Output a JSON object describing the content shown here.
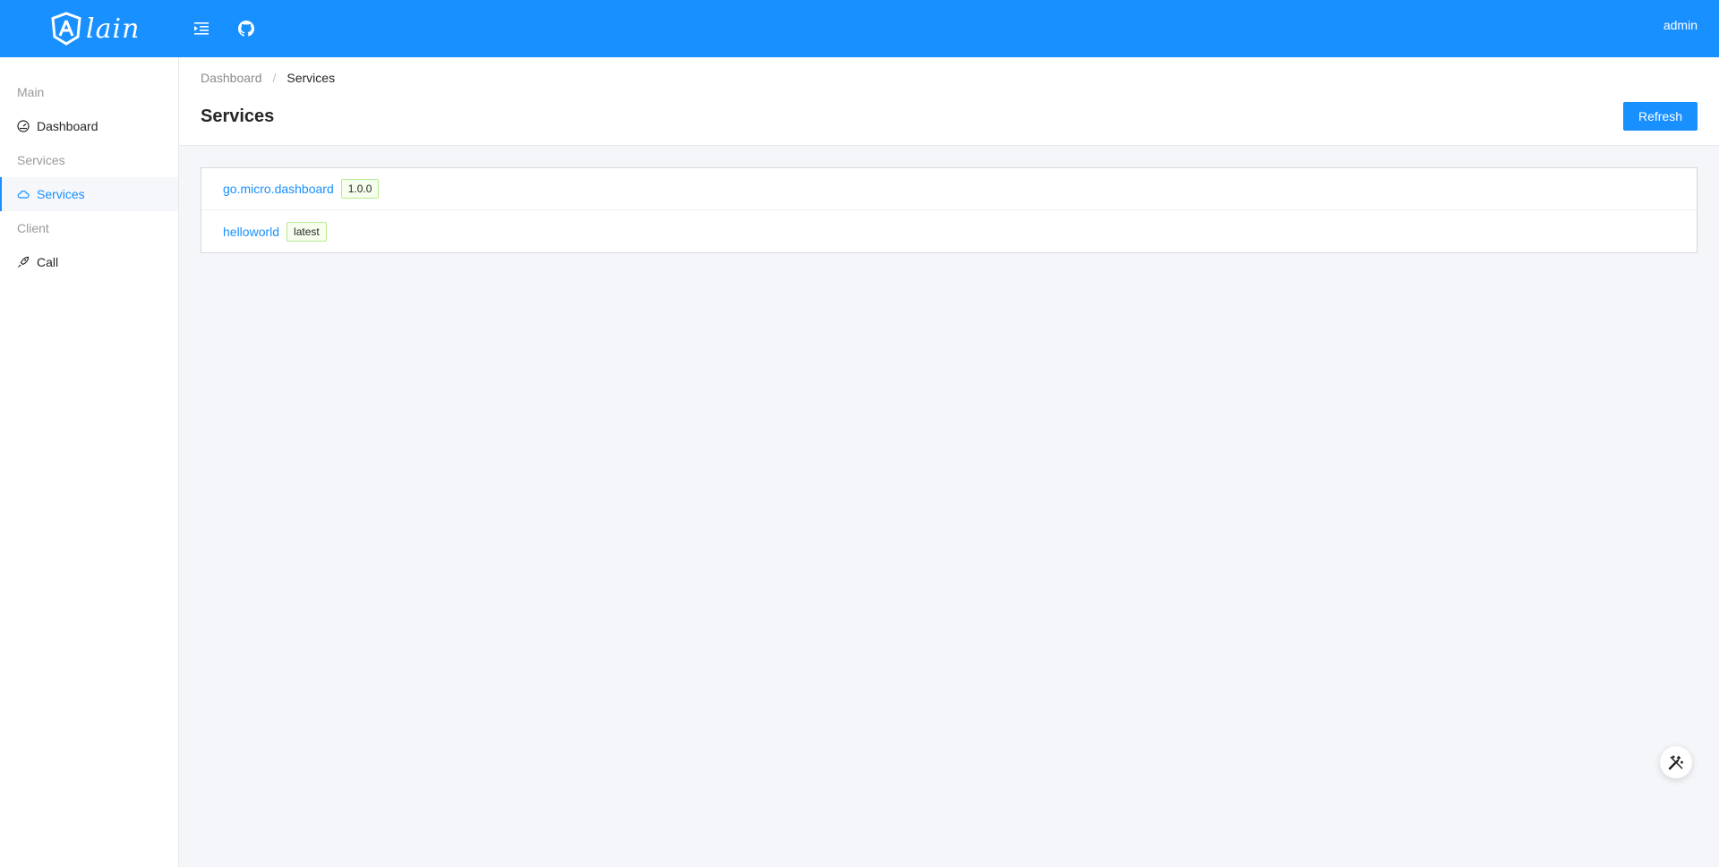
{
  "header": {
    "logo_text": "lain",
    "user_name": "admin",
    "brand_color": "#1890ff"
  },
  "sidebar": {
    "groups": [
      {
        "label": "Main",
        "items": [
          {
            "label": "Dashboard",
            "icon": "dashboard-icon",
            "active": false
          }
        ]
      },
      {
        "label": "Services",
        "items": [
          {
            "label": "Services",
            "icon": "cloud-icon",
            "active": true
          }
        ]
      },
      {
        "label": "Client",
        "items": [
          {
            "label": "Call",
            "icon": "rocket-icon",
            "active": false
          }
        ]
      }
    ]
  },
  "breadcrumb": {
    "items": [
      "Dashboard",
      "Services"
    ],
    "separator": "/"
  },
  "page": {
    "title": "Services",
    "refresh_label": "Refresh"
  },
  "services": [
    {
      "name": "go.micro.dashboard",
      "version": "1.0.0"
    },
    {
      "name": "helloworld",
      "version": "latest"
    }
  ],
  "fab": {
    "icon": "magic-wand-icon"
  }
}
